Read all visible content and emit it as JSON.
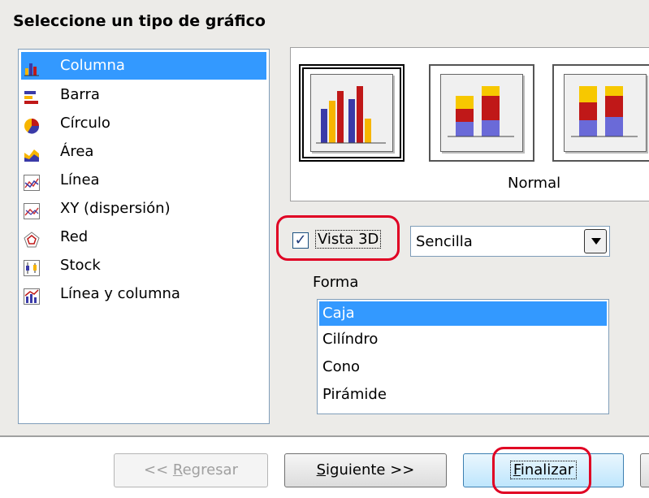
{
  "dialog": {
    "title": "Seleccione un tipo de gráfico"
  },
  "chart_types": [
    {
      "label": "Columna",
      "icon": "column-chart-icon",
      "selected": true
    },
    {
      "label": "Barra",
      "icon": "bar-chart-icon",
      "selected": false
    },
    {
      "label": "Círculo",
      "icon": "pie-chart-icon",
      "selected": false
    },
    {
      "label": "Área",
      "icon": "area-chart-icon",
      "selected": false
    },
    {
      "label": "Línea",
      "icon": "line-chart-icon",
      "selected": false
    },
    {
      "label": "XY (dispersión)",
      "icon": "xy-scatter-icon",
      "selected": false
    },
    {
      "label": "Red",
      "icon": "net-chart-icon",
      "selected": false
    },
    {
      "label": "Stock",
      "icon": "stock-chart-icon",
      "selected": false
    },
    {
      "label": "Línea y columna",
      "icon": "line-column-chart-icon",
      "selected": false
    }
  ],
  "variants": {
    "selected_label": "Normal",
    "items": [
      "normal",
      "stacked",
      "percent-stacked"
    ]
  },
  "options": {
    "vista3d_label": "Vista 3D",
    "vista3d_checked": true,
    "style_select_value": "Sencilla",
    "forma_label": "Forma",
    "shapes": [
      {
        "label": "Caja",
        "selected": true
      },
      {
        "label": "Cilíndro",
        "selected": false
      },
      {
        "label": "Cono",
        "selected": false
      },
      {
        "label": "Pirámide",
        "selected": false
      }
    ]
  },
  "buttons": {
    "back": {
      "pre": "<< ",
      "u": "R",
      "post": "egresar"
    },
    "next": {
      "u": "S",
      "post": "iguiente >>"
    },
    "finish": {
      "u": "F",
      "post": "inalizar"
    }
  },
  "colors": {
    "selection": "#3399ff",
    "highlight_ring": "#e00023"
  }
}
